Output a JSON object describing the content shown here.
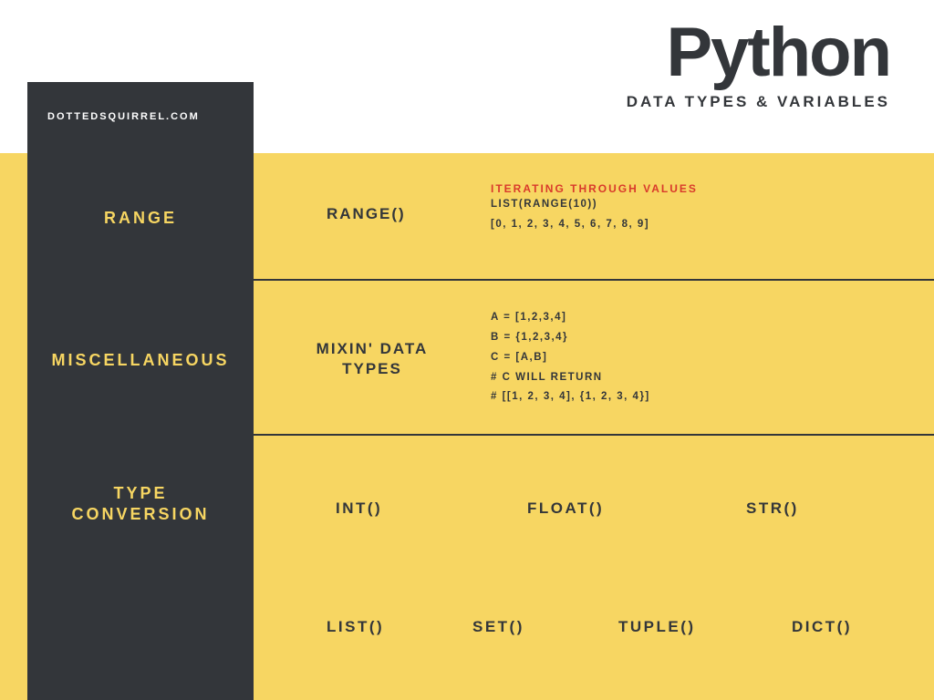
{
  "header": {
    "title": "Python",
    "subtitle": "DATA TYPES & VARIABLES"
  },
  "site": "DOTTEDSQUIRREL.COM",
  "sidebar": {
    "range": "RANGE",
    "misc": "MISCELLANEOUS",
    "typeconv1": "TYPE",
    "typeconv2": "CONVERSION"
  },
  "range": {
    "func": "RANGE()",
    "red": "ITERATING THROUGH VALUES",
    "l1": "LIST(RANGE(10))",
    "l2": "[0, 1, 2, 3, 4, 5, 6, 7, 8, 9]"
  },
  "misc": {
    "h1": "MIXIN' DATA",
    "h2": "TYPES",
    "l1": "A = [1,2,3,4]",
    "l2": "B = {1,2,3,4}",
    "l3": "C = [A,B]",
    "l4": "# C WILL RETURN",
    "l5": "# [[1, 2, 3, 4], {1, 2, 3, 4}]"
  },
  "conv": {
    "int": "INT()",
    "float": "FLOAT()",
    "str": "STR()",
    "list": "LIST()",
    "set": "SET()",
    "tuple": "TUPLE()",
    "dict": "DICT()"
  }
}
